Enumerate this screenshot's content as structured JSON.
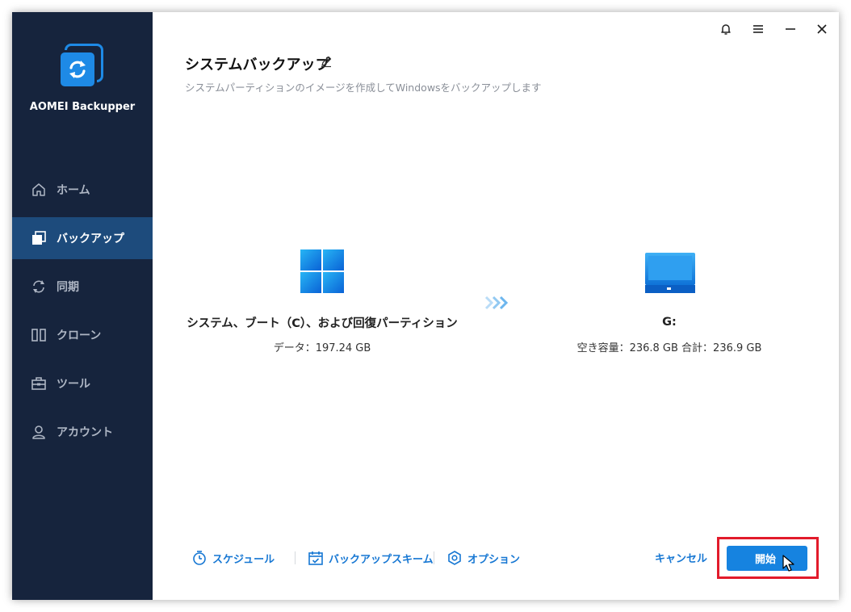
{
  "app": {
    "name": "AOMEI Backupper"
  },
  "sidebar": {
    "items": [
      {
        "label": "ホーム",
        "icon": "home-icon",
        "active": false
      },
      {
        "label": "バックアップ",
        "icon": "backup-icon",
        "active": true
      },
      {
        "label": "同期",
        "icon": "sync-icon",
        "active": false
      },
      {
        "label": "クローン",
        "icon": "clone-icon",
        "active": false
      },
      {
        "label": "ツール",
        "icon": "tools-icon",
        "active": false
      },
      {
        "label": "アカウント",
        "icon": "account-icon",
        "active": false
      }
    ]
  },
  "titlebar": {
    "icons": [
      "bell-icon",
      "menu-icon",
      "minimize-icon",
      "close-icon"
    ]
  },
  "page": {
    "title": "システムバックアップ",
    "subtitle": "システムパーティションのイメージを作成してWindowsをバックアップします"
  },
  "source": {
    "label": "システム、ブート（C）、および回復パーティション",
    "info": "データ：197.24 GB",
    "icon": "windows-icon"
  },
  "destination": {
    "label": "G:",
    "info": "空き容量：236.8 GB 合計：236.9 GB",
    "icon": "monitor-icon"
  },
  "footer": {
    "schedule_label": "スケジュール",
    "scheme_label": "バックアップスキーム",
    "options_label": "オプション",
    "cancel_label": "キャンセル",
    "start_label": "開始"
  },
  "colors": {
    "sidebar_bg": "#16243d",
    "sidebar_active": "#1d4b7c",
    "accent": "#1683e0",
    "highlight": "#e21b2b"
  }
}
